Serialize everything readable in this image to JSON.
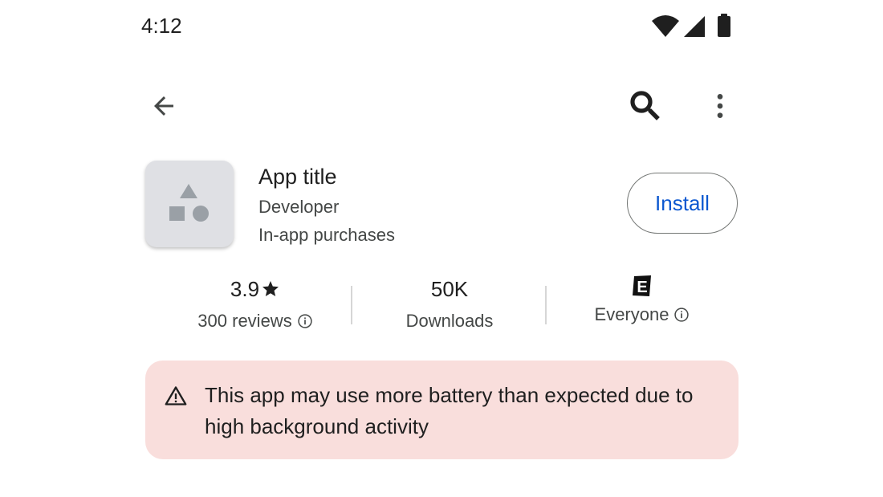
{
  "status_bar": {
    "time": "4:12",
    "icons": [
      "wifi-icon",
      "cellular-signal-icon",
      "battery-icon"
    ]
  },
  "top_bar": {
    "icons": [
      "back-arrow-icon",
      "search-icon",
      "more-vert-icon"
    ]
  },
  "app": {
    "title": "App title",
    "developer": "Developer",
    "purchases": "In-app purchases",
    "icon": "app-shapes-icon",
    "install_label": "Install"
  },
  "stats": {
    "rating": {
      "value": "3.9",
      "label": "300 reviews"
    },
    "downloads": {
      "value": "50K",
      "label": "Downloads"
    },
    "content_rating": {
      "badge": "E",
      "label": "Everyone"
    }
  },
  "warning": {
    "icon": "warning-triangle-icon",
    "text": "This app may use more battery than expected due to high background activity"
  },
  "colors": {
    "accent": "#0b57d0",
    "warning_bg": "#f9dedc",
    "text_primary": "#1f1f1f",
    "text_secondary": "#444746"
  }
}
